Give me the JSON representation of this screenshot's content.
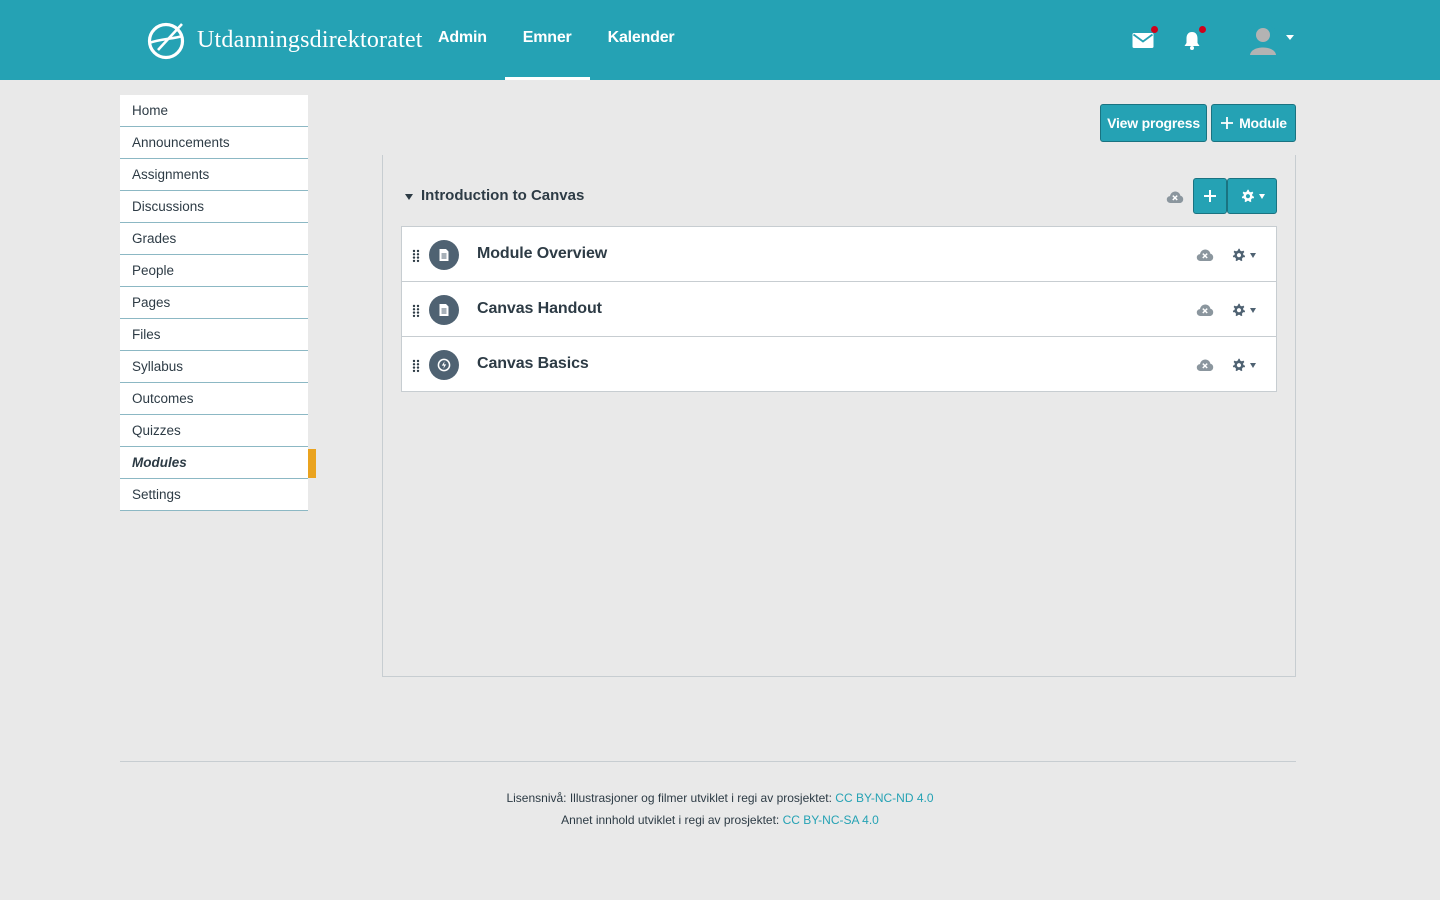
{
  "brand": {
    "name": "Utdanningsdirektoratet",
    "logo_icon": "udir-logo-icon"
  },
  "topnav": {
    "items": [
      {
        "label": "Admin",
        "active": false
      },
      {
        "label": "Emner",
        "active": true
      },
      {
        "label": "Kalender",
        "active": false
      }
    ]
  },
  "header_icons": {
    "inbox": "mail-icon",
    "notifications": "bell-icon",
    "avatar": "user-avatar-icon",
    "unread_dot_color": "#d0021b"
  },
  "sidebar": {
    "items": [
      {
        "label": "Home"
      },
      {
        "label": "Announcements"
      },
      {
        "label": "Assignments"
      },
      {
        "label": "Discussions"
      },
      {
        "label": "Grades"
      },
      {
        "label": "People"
      },
      {
        "label": "Pages"
      },
      {
        "label": "Files"
      },
      {
        "label": "Syllabus"
      },
      {
        "label": "Outcomes"
      },
      {
        "label": "Quizzes"
      },
      {
        "label": "Modules",
        "active": true
      },
      {
        "label": "Settings"
      }
    ],
    "active_indicator_color": "#eaa31f"
  },
  "toolbar": {
    "view_progress_label": "View progress",
    "add_module_label": "Module",
    "add_module_icon": "plus-icon"
  },
  "module": {
    "title": "Introduction to Canvas",
    "items": [
      {
        "title": "Module Overview",
        "type_icon": "page-icon"
      },
      {
        "title": "Canvas Handout",
        "type_icon": "page-icon"
      },
      {
        "title": "Canvas Basics",
        "type_icon": "external-tool-icon"
      }
    ]
  },
  "footer": {
    "line1_text": "Lisensnivå: Illustrasjoner og filmer utviklet i regi av prosjektet:",
    "line1_link": "CC BY-NC-ND 4.0",
    "line2_text": "Annet innhold utviklet i regi av prosjektet:",
    "line2_link": "CC BY-NC-SA 4.0"
  },
  "colors": {
    "brand_teal": "#25a2b4",
    "text_dark": "#2d3b45",
    "background": "#e9e9e9"
  }
}
